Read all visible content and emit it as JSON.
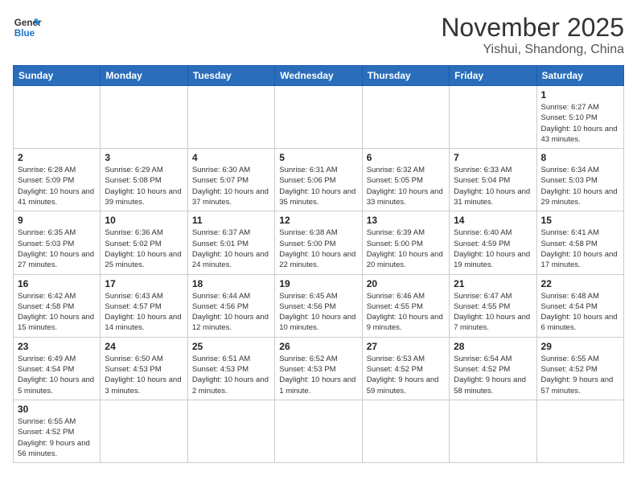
{
  "logo": {
    "line1": "General",
    "line2": "Blue"
  },
  "header": {
    "month": "November 2025",
    "location": "Yishui, Shandong, China"
  },
  "weekdays": [
    "Sunday",
    "Monday",
    "Tuesday",
    "Wednesday",
    "Thursday",
    "Friday",
    "Saturday"
  ],
  "weeks": [
    [
      {
        "day": "",
        "info": ""
      },
      {
        "day": "",
        "info": ""
      },
      {
        "day": "",
        "info": ""
      },
      {
        "day": "",
        "info": ""
      },
      {
        "day": "",
        "info": ""
      },
      {
        "day": "",
        "info": ""
      },
      {
        "day": "1",
        "info": "Sunrise: 6:27 AM\nSunset: 5:10 PM\nDaylight: 10 hours and 43 minutes."
      }
    ],
    [
      {
        "day": "2",
        "info": "Sunrise: 6:28 AM\nSunset: 5:09 PM\nDaylight: 10 hours and 41 minutes."
      },
      {
        "day": "3",
        "info": "Sunrise: 6:29 AM\nSunset: 5:08 PM\nDaylight: 10 hours and 39 minutes."
      },
      {
        "day": "4",
        "info": "Sunrise: 6:30 AM\nSunset: 5:07 PM\nDaylight: 10 hours and 37 minutes."
      },
      {
        "day": "5",
        "info": "Sunrise: 6:31 AM\nSunset: 5:06 PM\nDaylight: 10 hours and 35 minutes."
      },
      {
        "day": "6",
        "info": "Sunrise: 6:32 AM\nSunset: 5:05 PM\nDaylight: 10 hours and 33 minutes."
      },
      {
        "day": "7",
        "info": "Sunrise: 6:33 AM\nSunset: 5:04 PM\nDaylight: 10 hours and 31 minutes."
      },
      {
        "day": "8",
        "info": "Sunrise: 6:34 AM\nSunset: 5:03 PM\nDaylight: 10 hours and 29 minutes."
      }
    ],
    [
      {
        "day": "9",
        "info": "Sunrise: 6:35 AM\nSunset: 5:03 PM\nDaylight: 10 hours and 27 minutes."
      },
      {
        "day": "10",
        "info": "Sunrise: 6:36 AM\nSunset: 5:02 PM\nDaylight: 10 hours and 25 minutes."
      },
      {
        "day": "11",
        "info": "Sunrise: 6:37 AM\nSunset: 5:01 PM\nDaylight: 10 hours and 24 minutes."
      },
      {
        "day": "12",
        "info": "Sunrise: 6:38 AM\nSunset: 5:00 PM\nDaylight: 10 hours and 22 minutes."
      },
      {
        "day": "13",
        "info": "Sunrise: 6:39 AM\nSunset: 5:00 PM\nDaylight: 10 hours and 20 minutes."
      },
      {
        "day": "14",
        "info": "Sunrise: 6:40 AM\nSunset: 4:59 PM\nDaylight: 10 hours and 19 minutes."
      },
      {
        "day": "15",
        "info": "Sunrise: 6:41 AM\nSunset: 4:58 PM\nDaylight: 10 hours and 17 minutes."
      }
    ],
    [
      {
        "day": "16",
        "info": "Sunrise: 6:42 AM\nSunset: 4:58 PM\nDaylight: 10 hours and 15 minutes."
      },
      {
        "day": "17",
        "info": "Sunrise: 6:43 AM\nSunset: 4:57 PM\nDaylight: 10 hours and 14 minutes."
      },
      {
        "day": "18",
        "info": "Sunrise: 6:44 AM\nSunset: 4:56 PM\nDaylight: 10 hours and 12 minutes."
      },
      {
        "day": "19",
        "info": "Sunrise: 6:45 AM\nSunset: 4:56 PM\nDaylight: 10 hours and 10 minutes."
      },
      {
        "day": "20",
        "info": "Sunrise: 6:46 AM\nSunset: 4:55 PM\nDaylight: 10 hours and 9 minutes."
      },
      {
        "day": "21",
        "info": "Sunrise: 6:47 AM\nSunset: 4:55 PM\nDaylight: 10 hours and 7 minutes."
      },
      {
        "day": "22",
        "info": "Sunrise: 6:48 AM\nSunset: 4:54 PM\nDaylight: 10 hours and 6 minutes."
      }
    ],
    [
      {
        "day": "23",
        "info": "Sunrise: 6:49 AM\nSunset: 4:54 PM\nDaylight: 10 hours and 5 minutes."
      },
      {
        "day": "24",
        "info": "Sunrise: 6:50 AM\nSunset: 4:53 PM\nDaylight: 10 hours and 3 minutes."
      },
      {
        "day": "25",
        "info": "Sunrise: 6:51 AM\nSunset: 4:53 PM\nDaylight: 10 hours and 2 minutes."
      },
      {
        "day": "26",
        "info": "Sunrise: 6:52 AM\nSunset: 4:53 PM\nDaylight: 10 hours and 1 minute."
      },
      {
        "day": "27",
        "info": "Sunrise: 6:53 AM\nSunset: 4:52 PM\nDaylight: 9 hours and 59 minutes."
      },
      {
        "day": "28",
        "info": "Sunrise: 6:54 AM\nSunset: 4:52 PM\nDaylight: 9 hours and 58 minutes."
      },
      {
        "day": "29",
        "info": "Sunrise: 6:55 AM\nSunset: 4:52 PM\nDaylight: 9 hours and 57 minutes."
      }
    ],
    [
      {
        "day": "30",
        "info": "Sunrise: 6:55 AM\nSunset: 4:52 PM\nDaylight: 9 hours and 56 minutes."
      },
      {
        "day": "",
        "info": ""
      },
      {
        "day": "",
        "info": ""
      },
      {
        "day": "",
        "info": ""
      },
      {
        "day": "",
        "info": ""
      },
      {
        "day": "",
        "info": ""
      },
      {
        "day": "",
        "info": ""
      }
    ]
  ]
}
